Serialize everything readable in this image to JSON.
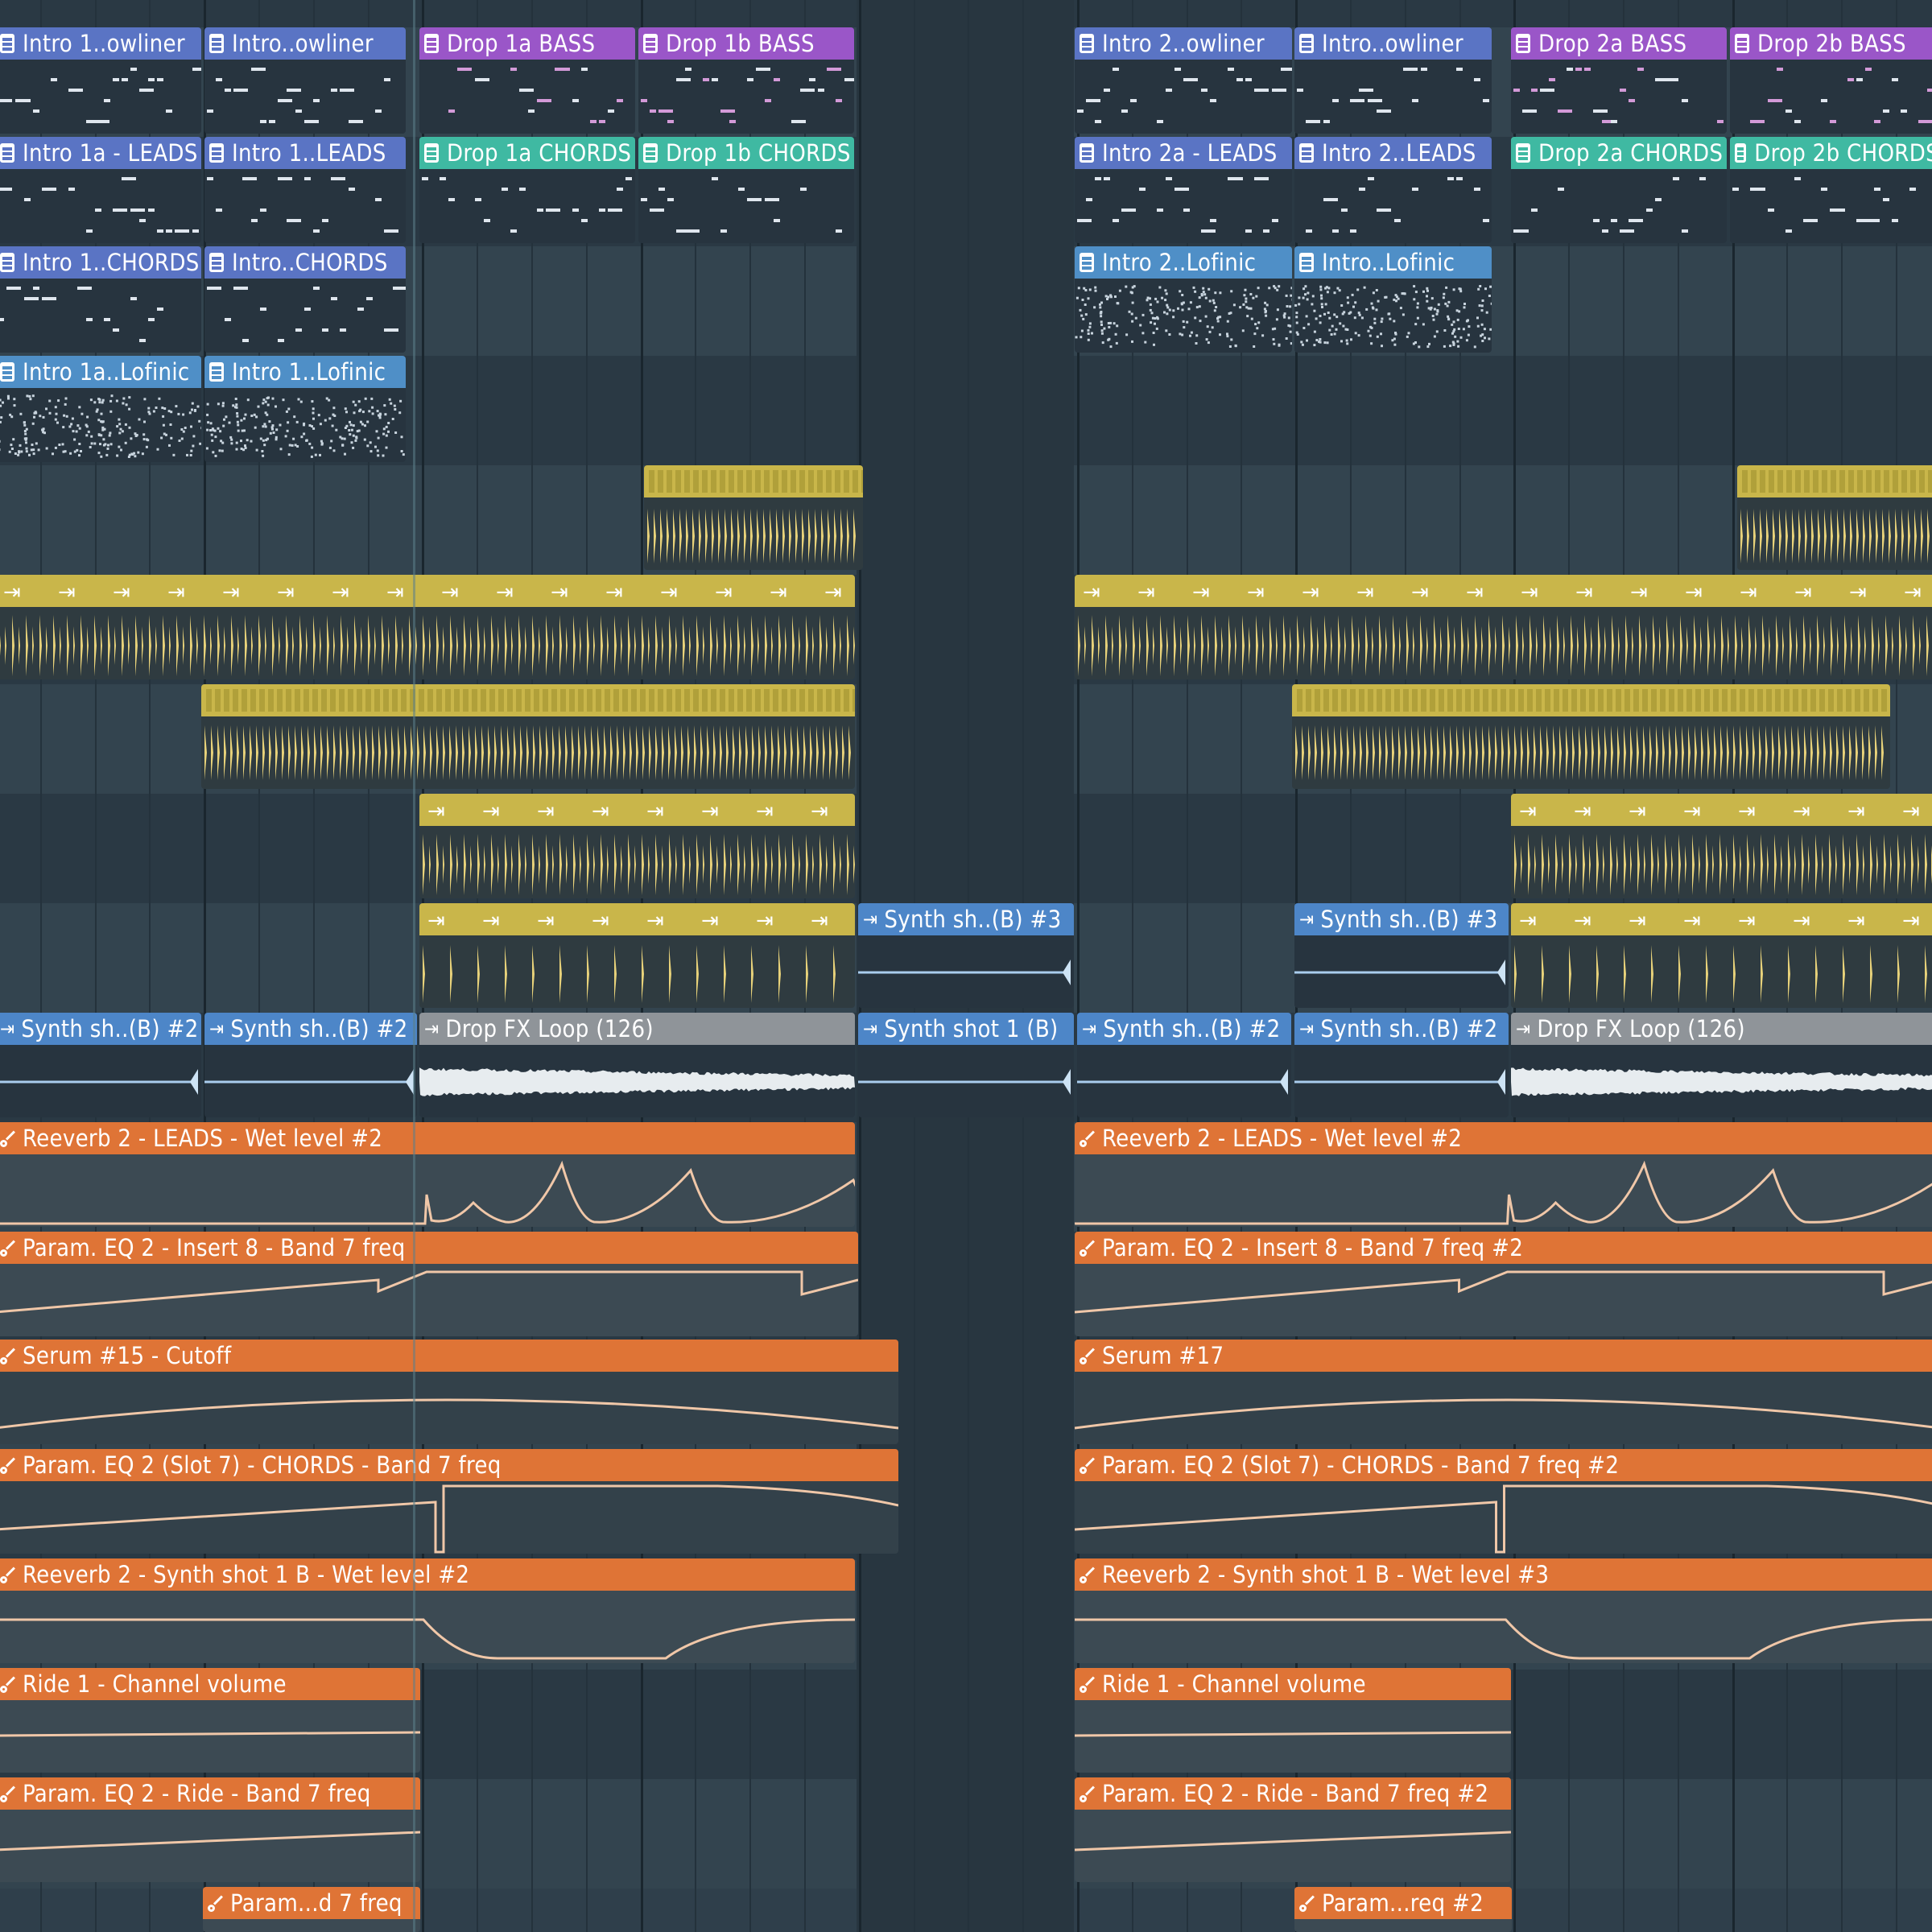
{
  "colors": {
    "pattern_blue": "#5a74c4",
    "pattern_purple": "#9a56c8",
    "pattern_teal": "#3fb9a2",
    "pattern_lofi": "#4f8fc7",
    "audio_yellow": "#c9b64a",
    "audio_blue": "#4d86c8",
    "audio_grey": "#8f9499",
    "automation_orange": "#df7436"
  },
  "pattern_clips": [
    {
      "label": "Intro 1..owliner",
      "color": "blue"
    },
    {
      "label": "Intro..owliner",
      "color": "blue"
    },
    {
      "label": "Drop 1a BASS",
      "color": "purple"
    },
    {
      "label": "Drop 1b BASS",
      "color": "purple"
    },
    {
      "label": "Intro 2..owliner",
      "color": "blue"
    },
    {
      "label": "Intro..owliner",
      "color": "blue"
    },
    {
      "label": "Drop 2a BASS",
      "color": "purple"
    },
    {
      "label": "Drop 2b BASS",
      "color": "purple"
    },
    {
      "label": "Intro 1a - LEADS",
      "color": "blue"
    },
    {
      "label": "Intro 1..LEADS",
      "color": "blue"
    },
    {
      "label": "Drop 1a CHORDS",
      "color": "teal"
    },
    {
      "label": "Drop 1b CHORDS",
      "color": "teal"
    },
    {
      "label": "Intro 2a - LEADS",
      "color": "blue"
    },
    {
      "label": "Intro 2..LEADS",
      "color": "blue"
    },
    {
      "label": "Drop 2a CHORDS",
      "color": "teal"
    },
    {
      "label": "Drop 2b CHORDS",
      "color": "teal"
    },
    {
      "label": "Intro 1..CHORDS",
      "color": "blue"
    },
    {
      "label": "Intro..CHORDS",
      "color": "blue"
    },
    {
      "label": "Intro 2..Lofinic",
      "color": "lofi"
    },
    {
      "label": "Intro..Lofinic",
      "color": "lofi"
    },
    {
      "label": "Intro 1a..Lofinic",
      "color": "lofi"
    },
    {
      "label": "Intro 1..Lofinic",
      "color": "lofi"
    }
  ],
  "audio_clips": [
    {
      "label": "Synth sh..(B) #3"
    },
    {
      "label": "Synth sh..(B) #3"
    },
    {
      "label": "Synth sh..(B) #2"
    },
    {
      "label": "Synth sh..(B) #2"
    },
    {
      "label": "Drop FX Loop (126)"
    },
    {
      "label": "Synth shot 1 (B)"
    },
    {
      "label": "Synth sh..(B) #2"
    },
    {
      "label": "Synth sh..(B) #2"
    },
    {
      "label": "Drop FX Loop (126)"
    }
  ],
  "automation_clips": [
    {
      "label": "Reeverb 2 - LEADS - Wet level #2"
    },
    {
      "label": "Reeverb 2 - LEADS - Wet level #2"
    },
    {
      "label": "Param. EQ 2 - Insert 8 - Band 7 freq"
    },
    {
      "label": "Param. EQ 2 - Insert 8 - Band 7 freq #2"
    },
    {
      "label": "Serum #15 - Cutoff"
    },
    {
      "label": "Serum #17"
    },
    {
      "label": "Param. EQ 2 (Slot 7) - CHORDS - Band 7 freq"
    },
    {
      "label": "Param. EQ 2 (Slot 7) - CHORDS - Band 7 freq #2"
    },
    {
      "label": "Reeverb 2 - Synth shot 1 B - Wet level #2"
    },
    {
      "label": "Reeverb 2 - Synth shot 1 B - Wet level #3"
    },
    {
      "label": "Ride 1 - Channel volume"
    },
    {
      "label": "Ride 1 - Channel volume"
    },
    {
      "label": "Param. EQ 2 - Ride - Band 7 freq"
    },
    {
      "label": "Param. EQ 2 - Ride - Band 7 freq #2"
    },
    {
      "label": "Param...d 7 freq"
    },
    {
      "label": "Param...req #2"
    }
  ]
}
